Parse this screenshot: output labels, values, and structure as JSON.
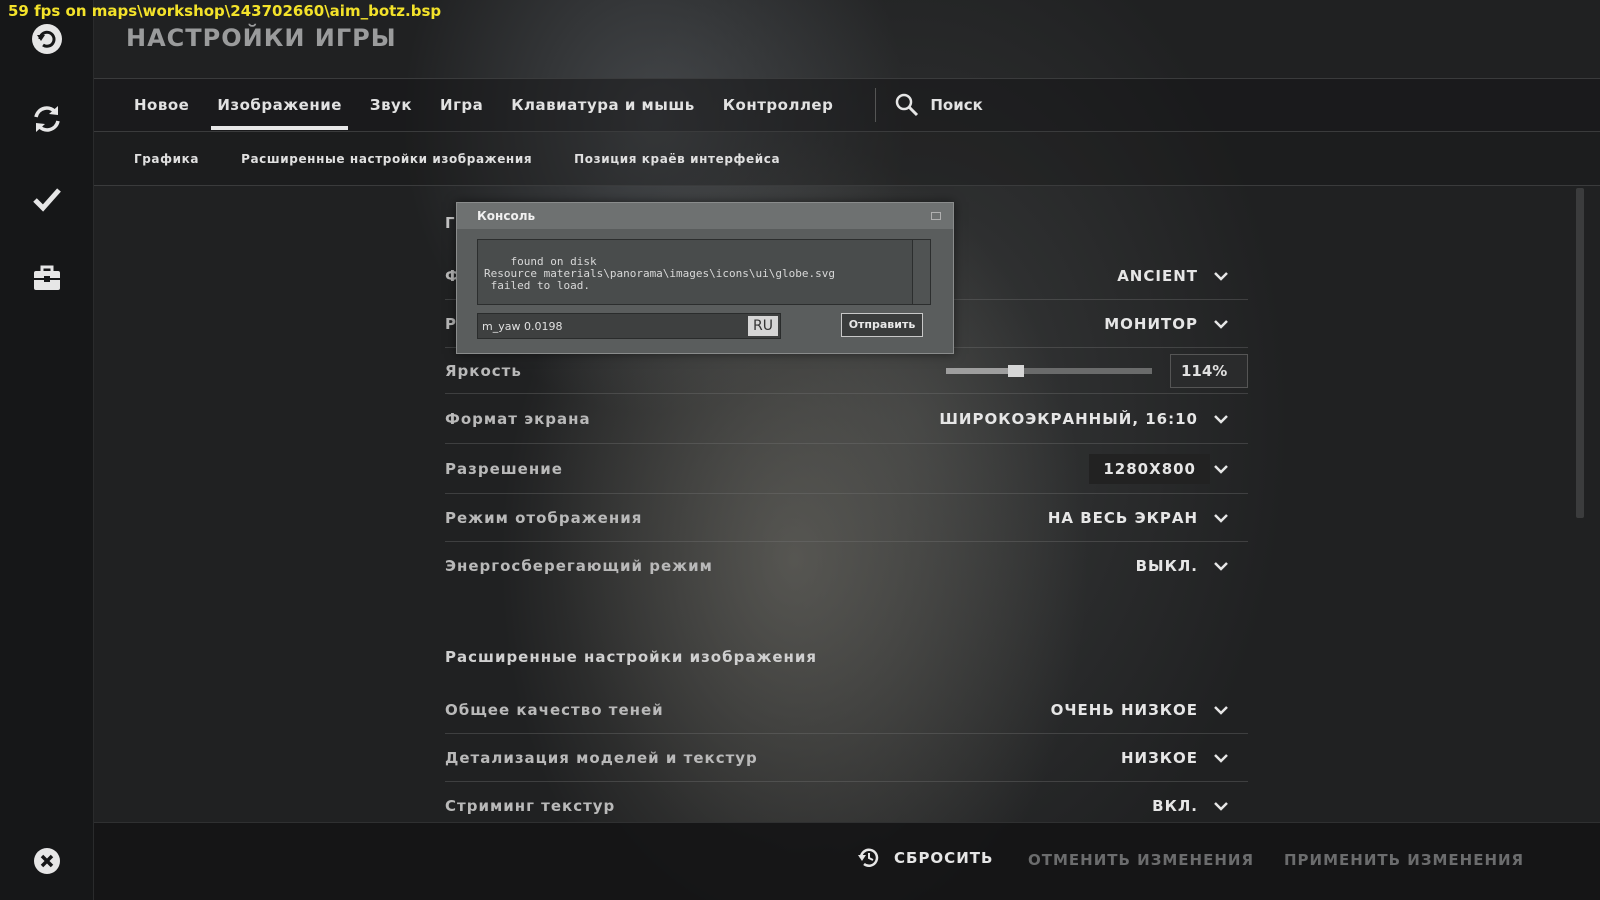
{
  "overlay": {
    "fps_text": "59 fps on maps\\workshop\\243702660\\aim_botz.bsp"
  },
  "header": {
    "title": "НАСТРОЙКИ ИГРЫ"
  },
  "tabs": [
    {
      "label": "Новое"
    },
    {
      "label": "Изображение",
      "active": true
    },
    {
      "label": "Звук"
    },
    {
      "label": "Игра"
    },
    {
      "label": "Клавиатура и мышь"
    },
    {
      "label": "Контроллер"
    }
  ],
  "search": {
    "label": "Поиск"
  },
  "subtabs": [
    {
      "label": "Графика"
    },
    {
      "label": "Расширенные настройки изображения"
    },
    {
      "label": "Позиция краёв интерфейса"
    }
  ],
  "settings": {
    "hidden_rows": [
      {
        "peek": "Г"
      },
      {
        "peek": "Ф",
        "value": "ANCIENT"
      },
      {
        "peek": "Р",
        "value": "МОНИТОР"
      }
    ],
    "brightness": {
      "label": "Яркость",
      "value": "114%",
      "level": 0.34
    },
    "rows": [
      {
        "label": "Формат экрана",
        "value": "ШИРОКОЭКРАННЫЙ, 16:10"
      },
      {
        "label": "Разрешение",
        "value": "1280X800"
      },
      {
        "label": "Режим отображения",
        "value": "НА ВЕСЬ ЭКРАН"
      },
      {
        "label": "Энергосберегающий режим",
        "value": "ВЫКЛ."
      }
    ],
    "advanced_title": "Расширенные настройки изображения",
    "advanced_rows": [
      {
        "label": "Общее качество теней",
        "value": "ОЧЕНЬ НИЗКОЕ"
      },
      {
        "label": "Детализация моделей и текстур",
        "value": "НИЗКОЕ"
      },
      {
        "label": "Стриминг текстур",
        "value": "ВКЛ."
      }
    ]
  },
  "console": {
    "title": "Консоль",
    "log": "found on disk\nResource materials\\panorama\\images\\icons\\ui\\globe.svg\n failed to load.",
    "input_value": "m_yaw 0.0198",
    "lang": "RU",
    "send_label": "Отправить"
  },
  "footer": {
    "reset_label": "СБРОСИТЬ",
    "cancel_label": "ОТМЕНИТЬ ИЗМЕНЕНИЯ",
    "apply_label": "ПРИМЕНИТЬ ИЗМЕНЕНИЯ"
  },
  "colors": {
    "fps_yellow": "#f3e22a",
    "accent_white": "#e8e8e8",
    "disabled_text": "#6b6c6d"
  },
  "icons": [
    "back-icon",
    "refresh-icon",
    "check-icon",
    "briefcase-icon",
    "close-icon",
    "search-icon",
    "reset-icon",
    "chevron-down-icon"
  ]
}
